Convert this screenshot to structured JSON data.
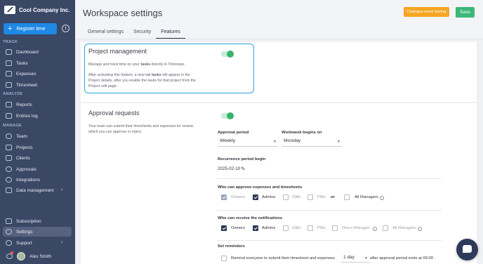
{
  "app": {
    "company": "Cool Company Inc."
  },
  "sidebar": {
    "register_label": "Register time",
    "sections": [
      {
        "label": "TRACK",
        "items": [
          "Dashboard",
          "Tasks",
          "Expenses",
          "Timesheet"
        ]
      },
      {
        "label": "ANALYZE",
        "items": [
          "Reports",
          "Entries log"
        ]
      },
      {
        "label": "MANAGE",
        "items": [
          "Team",
          "Projects",
          "Clients",
          "Approvals",
          "Integrations",
          "Data management"
        ]
      }
    ],
    "bottom": [
      "Subscription",
      "Settings",
      "Support"
    ],
    "user": "Alex Smith"
  },
  "header": {
    "title": "Workspace settings",
    "pending_label": "Changes need saving",
    "save_label": "Save"
  },
  "tabs": [
    "General settings",
    "Security",
    "Features"
  ],
  "active_tab": "Features",
  "project_management": {
    "title": "Project management",
    "desc1_a": "Manage and track time on your ",
    "desc1_b": "tasks",
    "desc1_c": " directly in Timeneye.",
    "desc2_a": "After activating this feature, a new tab ",
    "desc2_b": "tasks",
    "desc2_c": " will appear in the Project details, after you enable the tasks for that project from the Project edit page.",
    "enabled": true
  },
  "approval_requests": {
    "title": "Approval requests",
    "desc": "Your team can submit their timesheets and expenses for review, which you can approve or reject.",
    "enabled": true,
    "approval_period_label": "Approval period",
    "approval_period_value": "Weekly",
    "workweek_label": "Workweek begins on",
    "workweek_value": "Monday",
    "recurrence_label": "Recurrence period begin",
    "recurrence_value": "2025-02-10",
    "approvers_label": "Who can approve expenses and timesheets",
    "approvers": [
      {
        "label": "Owners",
        "checked": true,
        "disabled": true
      },
      {
        "label": "Admins",
        "checked": true,
        "disabled": false
      },
      {
        "label": "GMs",
        "checked": false,
        "disabled": false
      },
      {
        "label": "PMs",
        "checked": false,
        "disabled": false
      }
    ],
    "or_label": "or",
    "all_managers_label": "All Managers",
    "notif_label": "Who can receive the notifications",
    "notif": [
      {
        "label": "Owners",
        "checked": true
      },
      {
        "label": "Admins",
        "checked": true
      },
      {
        "label": "GMs",
        "checked": false
      },
      {
        "label": "PMs",
        "checked": false
      },
      {
        "label": "Direct Manager",
        "checked": false
      },
      {
        "label": "All Managers",
        "checked": false
      }
    ],
    "reminders_label": "Set reminders",
    "reminder_text": "Remind everyone to submit their timesheet and expenses",
    "reminder_amount": "1 day",
    "reminder_suffix": "after approval period ends at 09:00 ."
  },
  "colors": {
    "sidebar": "#3a4765",
    "accent": "#1e88e5",
    "save": "#3cb878",
    "pending": "#f6a623",
    "highlight": "#29a7d8"
  }
}
